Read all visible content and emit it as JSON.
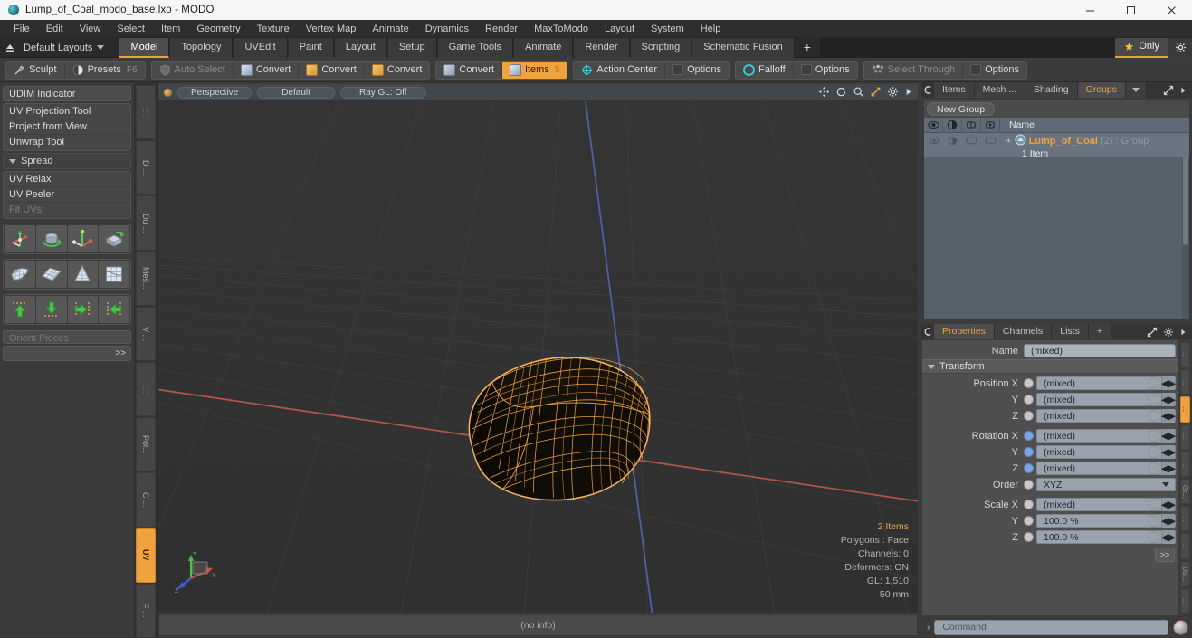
{
  "window": {
    "title": "Lump_of_Coal_modo_base.lxo - MODO",
    "minimize_label": "Minimize",
    "maximize_label": "Maximize",
    "close_label": "Close"
  },
  "menu": {
    "items": [
      "File",
      "Edit",
      "View",
      "Select",
      "Item",
      "Geometry",
      "Texture",
      "Vertex Map",
      "Animate",
      "Dynamics",
      "Render",
      "MaxToModo",
      "Layout",
      "System",
      "Help"
    ]
  },
  "layoutbar": {
    "layout_select": "Default Layouts",
    "tabs": [
      {
        "label": "Model",
        "active": true
      },
      {
        "label": "Topology",
        "active": false
      },
      {
        "label": "UVEdit",
        "active": false
      },
      {
        "label": "Paint",
        "active": false
      },
      {
        "label": "Layout",
        "active": false
      },
      {
        "label": "Setup",
        "active": false
      },
      {
        "label": "Game Tools",
        "active": false
      },
      {
        "label": "Animate",
        "active": false
      },
      {
        "label": "Render",
        "active": false
      },
      {
        "label": "Scripting",
        "active": false
      },
      {
        "label": "Schematic Fusion",
        "active": false
      }
    ],
    "add_tab_label": "+",
    "only_label": "Only",
    "gear_label": "Preferences"
  },
  "toolbar": {
    "sculpt_label": "Sculpt",
    "presets_label": "Presets",
    "presets_key": "F6",
    "auto_select_label": "Auto Select",
    "convert1_label": "Convert",
    "convert2_label": "Convert",
    "convert3_label": "Convert",
    "convert4_label": "Convert",
    "items_label": "Items",
    "items_count": "5",
    "action_center_label": "Action Center",
    "options1_label": "Options",
    "falloff_label": "Falloff",
    "options2_label": "Options",
    "select_through_label": "Select Through",
    "options3_label": "Options"
  },
  "left_panel": {
    "udim_indicator": "UDIM Indicator",
    "uv_projection_tool": "UV Projection Tool",
    "project_from_view": "Project from View",
    "unwrap_tool": "Unwrap Tool",
    "spread_label": "Spread",
    "uv_relax": "UV Relax",
    "uv_peeler": "UV Peeler",
    "fit_uvs": "Fit UVs",
    "orient_pieces": "Orient Pieces",
    "more_label": ">>",
    "vtabs": [
      {
        "label": ":::",
        "active": false
      },
      {
        "label": "D ...",
        "active": false
      },
      {
        "label": "Du ...",
        "active": false
      },
      {
        "label": "Mes...",
        "active": false
      },
      {
        "label": "V ...",
        "active": false
      },
      {
        "label": ":::",
        "active": false
      },
      {
        "label": "Pol...",
        "active": false
      },
      {
        "label": "C ...",
        "active": false
      },
      {
        "label": "UV",
        "active": true
      },
      {
        "label": "F ...",
        "active": false
      }
    ]
  },
  "viewport": {
    "view_mode": "Perspective",
    "shading_mode": "Default",
    "raygl_label": "Ray GL: Off",
    "info": {
      "items": "2 Items",
      "polygons": "Polygons : Face",
      "channels": "Channels: 0",
      "deformers": "Deformers: ON",
      "gl": "GL: 1,510",
      "scale": "50 mm"
    },
    "axis": {
      "x": "X",
      "y": "Y",
      "z": "Z"
    },
    "status": "(no info)"
  },
  "right_panel": {
    "tabs": [
      {
        "label": "Items",
        "active": false
      },
      {
        "label": "Mesh ...",
        "active": false
      },
      {
        "label": "Shading",
        "active": false
      },
      {
        "label": "Groups",
        "active": true
      }
    ],
    "new_group_label": "New Group",
    "tree_column_name": "Name",
    "group_row": {
      "name": "Lump_of_Coal",
      "count": "(2)",
      "type": ": Group",
      "sub": "1 Item"
    }
  },
  "properties": {
    "tabs": [
      {
        "label": "Properties",
        "active": true
      },
      {
        "label": "Channels",
        "active": false
      },
      {
        "label": "Lists",
        "active": false
      },
      {
        "label": "+",
        "active": false
      }
    ],
    "name_label": "Name",
    "name_value": "(mixed)",
    "transform_label": "Transform",
    "rows": [
      {
        "label": "Position X",
        "value": "(mixed)",
        "blue": false
      },
      {
        "label": "Y",
        "value": "(mixed)",
        "blue": false
      },
      {
        "label": "Z",
        "value": "(mixed)",
        "blue": false
      },
      {
        "label": "Rotation X",
        "value": "(mixed)",
        "blue": true
      },
      {
        "label": "Y",
        "value": "(mixed)",
        "blue": true
      },
      {
        "label": "Z",
        "value": "(mixed)",
        "blue": true
      }
    ],
    "order_label": "Order",
    "order_value": "XYZ",
    "scale_rows": [
      {
        "label": "Scale X",
        "value": "(mixed)"
      },
      {
        "label": "Y",
        "value": "100.0 %"
      },
      {
        "label": "Z",
        "value": "100.0 %"
      }
    ],
    "more_label": ">>",
    "vtabs": [
      {
        "label": ":::",
        "active": false
      },
      {
        "label": ":::",
        "active": false
      },
      {
        "label": ":::",
        "active": true
      },
      {
        "label": ":::",
        "active": false
      },
      {
        "label": ":::",
        "active": false
      },
      {
        "label": "Gr...",
        "active": false
      },
      {
        "label": ":::",
        "active": false
      },
      {
        "label": ":::",
        "active": false
      },
      {
        "label": "Us...",
        "active": false
      },
      {
        "label": ":::",
        "active": false
      }
    ]
  },
  "command": {
    "placeholder": "Command",
    "caret": "›"
  },
  "colors": {
    "accent": "#f0a23c",
    "wireframe": "#f2a33c",
    "viewport_bg": "#333333",
    "axis_x": "#b0554e",
    "axis_z": "#5a66b8"
  }
}
